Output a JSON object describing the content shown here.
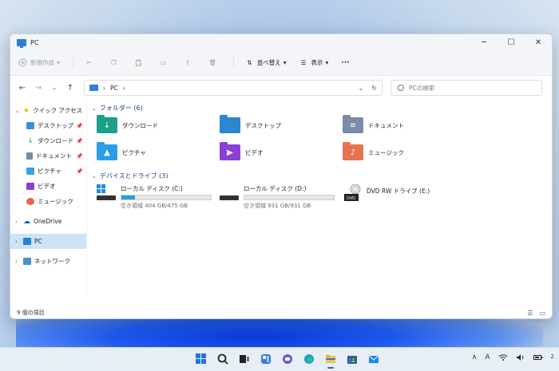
{
  "window": {
    "title": "PC",
    "controls": [
      "─",
      "☐",
      "✕"
    ]
  },
  "toolbar": {
    "new_label": "新規作成",
    "sort_label": "並べ替え",
    "view_label": "表示",
    "more_label": "···"
  },
  "address": {
    "crumb_pc": "PC",
    "crumb_sep": "›",
    "search_placeholder": "PCの検索"
  },
  "sidebar": {
    "quick_access": "クイック アクセス",
    "items": [
      {
        "label": "デスクトップ",
        "color": "#3a8fd6"
      },
      {
        "label": "ダウンロード",
        "color": "#1b9e77"
      },
      {
        "label": "ドキュメント",
        "color": "#7a8aa0"
      },
      {
        "label": "ピクチャ",
        "color": "#3aa0e0"
      },
      {
        "label": "ビデオ",
        "color": "#8a3fd0"
      },
      {
        "label": "ミュージック",
        "color": "#e2654a"
      }
    ],
    "onedrive": "OneDrive",
    "pc": "PC",
    "network": "ネットワーク"
  },
  "groups": {
    "folders_header": "フォルダー (6)",
    "drives_header": "デバイスとドライブ (3)"
  },
  "folders": [
    {
      "label": "ダウンロード",
      "color": "#1aa089",
      "glyph": "↓"
    },
    {
      "label": "デスクトップ",
      "color": "#2f86d0",
      "glyph": ""
    },
    {
      "label": "ドキュメント",
      "color": "#7b8ca8",
      "glyph": "≡"
    },
    {
      "label": "ピクチャ",
      "color": "#2a9ee6",
      "glyph": "▲"
    },
    {
      "label": "ビデオ",
      "color": "#8b3fd6",
      "glyph": "▶"
    },
    {
      "label": "ミュージック",
      "color": "#e8734f",
      "glyph": "♪"
    }
  ],
  "drives": [
    {
      "name": "ローカル ディスク (C:)",
      "free": "空き領域 404 GB/475 GB",
      "used_fraction": 0.15
    },
    {
      "name": "ローカル ディスク (D:)",
      "free": "空き領域 931 GB/931 GB",
      "used_fraction": 0.0
    },
    {
      "name": "DVD RW ドライブ (E:)"
    }
  ],
  "status": {
    "item_count": "9 個の項目"
  },
  "tray": {
    "chevron": "∧",
    "ime": "A",
    "clock_fragment": "2"
  }
}
